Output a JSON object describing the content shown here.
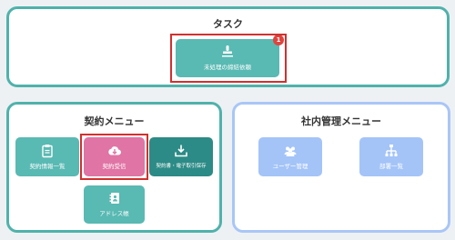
{
  "task": {
    "title": "タスク",
    "pending_button": {
      "label": "未処理の締結依頼",
      "badge": "1",
      "icon": "stamp-icon"
    }
  },
  "contract_menu": {
    "title": "契約メニュー",
    "items": [
      {
        "label": "契約情報一覧",
        "icon": "clipboard-icon"
      },
      {
        "label": "契約受信",
        "icon": "cloud-download-icon"
      },
      {
        "label": "契約書・電子取引保存",
        "icon": "tray-download-icon"
      },
      {
        "label": "アドレス帳",
        "icon": "address-book-icon"
      }
    ]
  },
  "internal_menu": {
    "title": "社内管理メニュー",
    "items": [
      {
        "label": "ユーザー管理",
        "icon": "users-icon"
      },
      {
        "label": "部署一覧",
        "icon": "org-chart-icon"
      }
    ]
  },
  "colors": {
    "teal": "#59b9b3",
    "pink": "#e074a4",
    "dark_teal": "#2c8b86",
    "light_blue": "#a4c4f8",
    "highlight_red": "#d0312f",
    "badge_red": "#e0433d"
  }
}
